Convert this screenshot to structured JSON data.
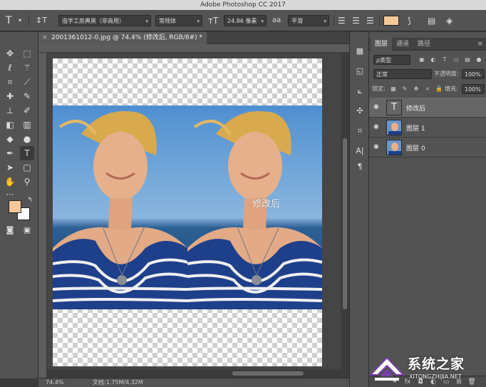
{
  "app": {
    "title": "Adobe Photoshop CC 2017"
  },
  "options_bar": {
    "tool_icon": "T",
    "font_family": "造字工房典黑（非商用）",
    "font_style": "常规体",
    "font_size": "24.86 像素",
    "anti_alias_label": "aa",
    "anti_alias": "平滑",
    "text_color": "#f6c99a"
  },
  "document": {
    "tab_title": "2001361012-0.jpg @ 74.4% (修改后, RGB/8#) *",
    "close_glyph": "×",
    "overlay_text": "修改后"
  },
  "tools": {
    "fg_color": "#f6c99a",
    "bg_color": "#ffffff"
  },
  "status": {
    "zoom": "74.4%",
    "doc_info": "文档:1.75M/4.32M"
  },
  "layers_panel": {
    "tabs": [
      "图层",
      "通道",
      "路径"
    ],
    "filter_label": "ρ类型",
    "blend_mode": "正常",
    "opacity_label": "不透明度:",
    "opacity_value": "100%",
    "lock_label": "锁定:",
    "fill_label": "填充:",
    "fill_value": "100%",
    "layers": [
      {
        "name": "修改后",
        "kind": "text",
        "selected": true
      },
      {
        "name": "图层 1",
        "kind": "image",
        "selected": false
      },
      {
        "name": "图层 0",
        "kind": "image",
        "selected": false
      }
    ],
    "bottom_icons": [
      "link-icon",
      "fx-icon",
      "mask-icon",
      "adjustment-icon",
      "group-icon",
      "new-layer-icon",
      "trash-icon"
    ],
    "fx_label": "fx"
  },
  "watermark": {
    "title": "系统之家",
    "url": "XITONGZHIJIA.NET"
  }
}
